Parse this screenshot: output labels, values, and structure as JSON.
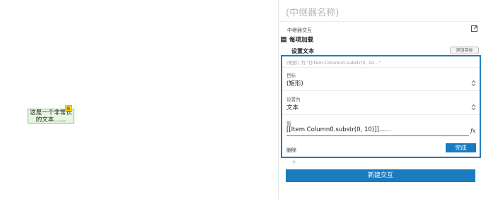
{
  "canvas": {
    "widget": {
      "line1": "这是一个非常长",
      "line2": "的文本……",
      "badge": "6"
    }
  },
  "panel": {
    "title": "(中继器名称)",
    "section_label": "中继器交互",
    "expand_icon": "expand-icon",
    "event": {
      "collapse_symbol": "−",
      "title": "每项加载"
    },
    "action": {
      "title": "设置文本",
      "add_target_label": "添加目标",
      "summary": "(矩形) 为 \"[[Item.Column0.substr(0, 10...\"",
      "target_label": "目标",
      "target_value": "(矩形)",
      "set_as_label": "设置为",
      "set_as_value": "文本",
      "value_label": "值",
      "value_text": "[[Item.Column0.substr(0, 10)]]……",
      "fx_label": "fx",
      "delete_label": "删除",
      "done_label": "完成"
    },
    "plus": "+",
    "new_interaction_label": "新建交互",
    "colors": {
      "accent": "#1a7bc0",
      "widget_fill": "#e7f6e2",
      "widget_border": "#6fc56f",
      "badge": "#f6d20b"
    }
  }
}
